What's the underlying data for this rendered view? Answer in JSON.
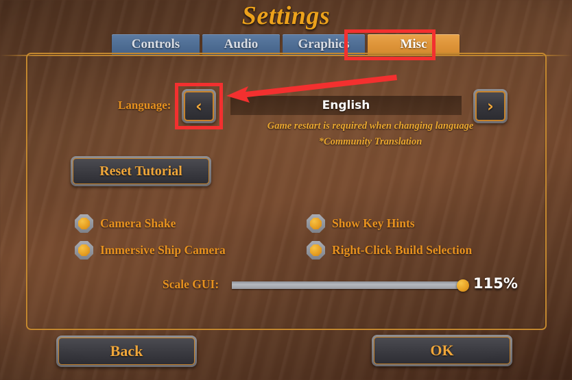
{
  "window": {
    "title": "Settings"
  },
  "tabs": [
    {
      "label": "Controls",
      "active": false
    },
    {
      "label": "Audio",
      "active": false
    },
    {
      "label": "Graphics",
      "active": false
    },
    {
      "label": "Misc",
      "active": true
    }
  ],
  "language_row": {
    "label": "Language:",
    "prev_icon": "chevron-left-icon",
    "next_icon": "chevron-right-icon",
    "prev_glyph": "‹",
    "next_glyph": "›",
    "value": "English",
    "note_restart": "Game restart is required when changing language",
    "note_community": "*Community Translation"
  },
  "reset_tutorial": {
    "label": "Reset Tutorial"
  },
  "checkboxes": [
    {
      "label": "Camera Shake",
      "checked": true
    },
    {
      "label": "Immersive Ship Camera",
      "checked": true
    },
    {
      "label": "Show Key Hints",
      "checked": true
    },
    {
      "label": "Right-Click Build Selection",
      "checked": true
    }
  ],
  "scale_gui": {
    "label": "Scale GUI:",
    "value_text": "115%",
    "value": 115,
    "min": 50,
    "max": 120,
    "fill_percent": 95
  },
  "footer": {
    "back_label": "Back",
    "ok_label": "OK"
  },
  "annotations": {
    "highlight_color": "#f3302f",
    "arrow_from": "misc-tab",
    "arrow_to": "language-previous-button",
    "boxes": [
      "misc-tab",
      "language-previous-button"
    ]
  },
  "colors": {
    "title_gold": "#eca11c",
    "label_orange": "#e8921f",
    "tab_active": "#dd9338",
    "tab_inactive": "#4e6d93",
    "panel_border": "#c5882f",
    "background_brown": "#6b452c",
    "annotation_red": "#f3302f"
  }
}
